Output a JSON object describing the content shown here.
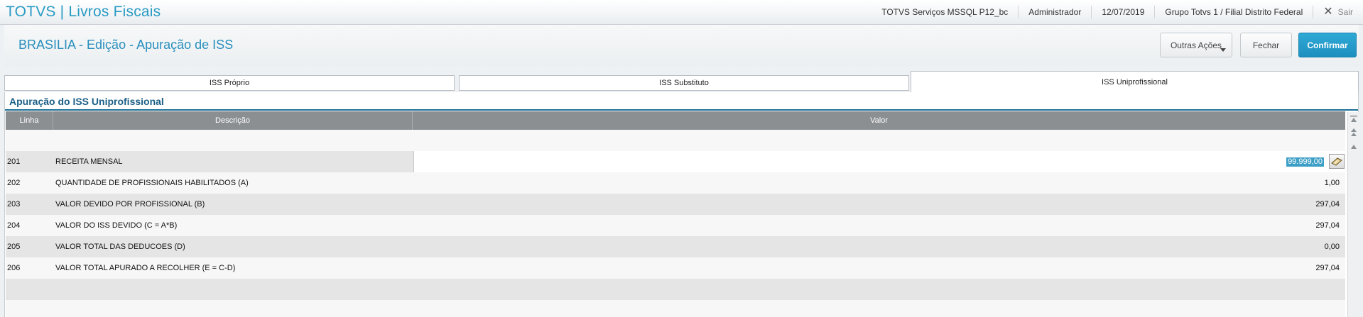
{
  "topbar": {
    "app_title": "TOTVS | Livros Fiscais",
    "environment": "TOTVS Serviços MSSQL P12_bc",
    "user": "Administrador",
    "date": "12/07/2019",
    "company": "Grupo Totvs 1 / Filial Distrito Federal",
    "logout_label": "Sair",
    "logout_icon": "close-icon"
  },
  "header": {
    "title": "BRASILIA -  Edição - Apuração de ISS",
    "outras_acoes_label": "Outras Ações",
    "fechar_label": "Fechar",
    "confirmar_label": "Confirmar"
  },
  "tabs": [
    {
      "label": "ISS Próprio",
      "active": false
    },
    {
      "label": "ISS Substituto",
      "active": false
    },
    {
      "label": "ISS Uniprofissional",
      "active": true
    }
  ],
  "section": {
    "title": "Apuração do ISS Uniprofissional"
  },
  "grid": {
    "columns": [
      "Linha",
      "Descrição",
      "Valor"
    ],
    "rows": [
      {
        "linha": "201",
        "descricao": "RECEITA MENSAL",
        "valor": "99.999,00",
        "editing": true
      },
      {
        "linha": "202",
        "descricao": "QUANTIDADE DE PROFISSIONAIS HABILITADOS (A)",
        "valor": "1,00"
      },
      {
        "linha": "203",
        "descricao": "VALOR DEVIDO POR PROFISSIONAL (B)",
        "valor": "297,04"
      },
      {
        "linha": "204",
        "descricao": "VALOR DO ISS DEVIDO (C = A*B)",
        "valor": "297,04"
      },
      {
        "linha": "205",
        "descricao": "VALOR TOTAL DAS DEDUCOES (D)",
        "valor": "0,00"
      },
      {
        "linha": "206",
        "descricao": "VALOR TOTAL APURADO A RECOLHER (E = C-D)",
        "valor": "297,04"
      }
    ]
  },
  "colors": {
    "accent": "#2a9bc4",
    "confirm_button": "#1e8fbf",
    "grid_header": "#8c8f92",
    "selection": "#3d9fc6"
  }
}
